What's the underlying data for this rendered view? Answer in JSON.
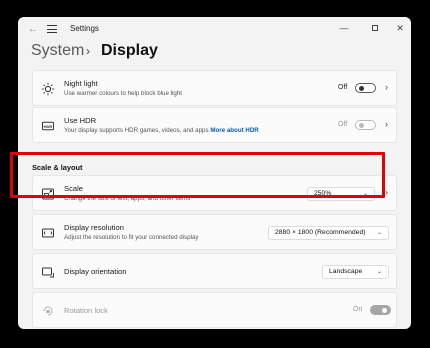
{
  "window": {
    "title": "Settings"
  },
  "breadcrumb": {
    "parent": "System",
    "separator": "›",
    "current": "Display"
  },
  "cards": {
    "night_light": {
      "title": "Night light",
      "desc": "Use warmer colours to help block blue light",
      "value": "Off",
      "state": "off"
    },
    "hdr": {
      "title": "Use HDR",
      "desc": "Your display supports HDR games, videos, and apps",
      "link": "More about HDR",
      "value": "Off",
      "state": "disabled"
    },
    "scale": {
      "title": "Scale",
      "desc": "Change the size of text, apps, and other items",
      "value": "250%"
    },
    "resolution": {
      "title": "Display resolution",
      "desc": "Adjust the resolution to fit your connected display",
      "value": "2880 × 1800 (Recommended)"
    },
    "orientation": {
      "title": "Display orientation",
      "value": "Landscape"
    },
    "rotation_lock": {
      "title": "Rotation lock",
      "value": "On",
      "state": "disabled-on"
    }
  },
  "section_scale_layout": "Scale & layout",
  "accent": {
    "highlight": "#e20000",
    "link": "#005fb8"
  },
  "icons": [
    "back-arrow-icon",
    "hamburger-menu-icon",
    "minimize-icon",
    "maximize-icon",
    "close-icon",
    "brightness-icon",
    "hdr-icon",
    "scale-icon",
    "resolution-icon",
    "orientation-icon",
    "rotation-lock-icon",
    "chevron-right-icon",
    "chevron-down-icon"
  ]
}
